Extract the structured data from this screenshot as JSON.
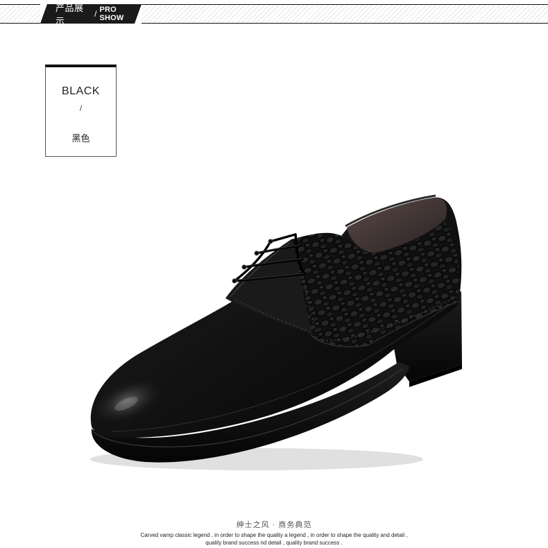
{
  "header": {
    "title_cn": "产品展示",
    "separator": "/",
    "title_en": "PRO SHOW"
  },
  "color_option": {
    "name_en": "BLACK",
    "separator": "/",
    "name_cn": "黑色"
  },
  "product": {
    "image_subject": "black leather lace-up derby shoe with crocodile-embossed quarter"
  },
  "captions": {
    "slogan": "绅士之风 · 商务典范",
    "description_line1": "Carved vamp classic legend , in order to shape the quality a legend , in order to shape the quality and detail ,",
    "description_line2": "quality brand success nd detail , quality brand success ."
  },
  "colors": {
    "header_bg": "#1a1a1a",
    "leather": "#0e0e0e",
    "background": "#ffffff"
  }
}
